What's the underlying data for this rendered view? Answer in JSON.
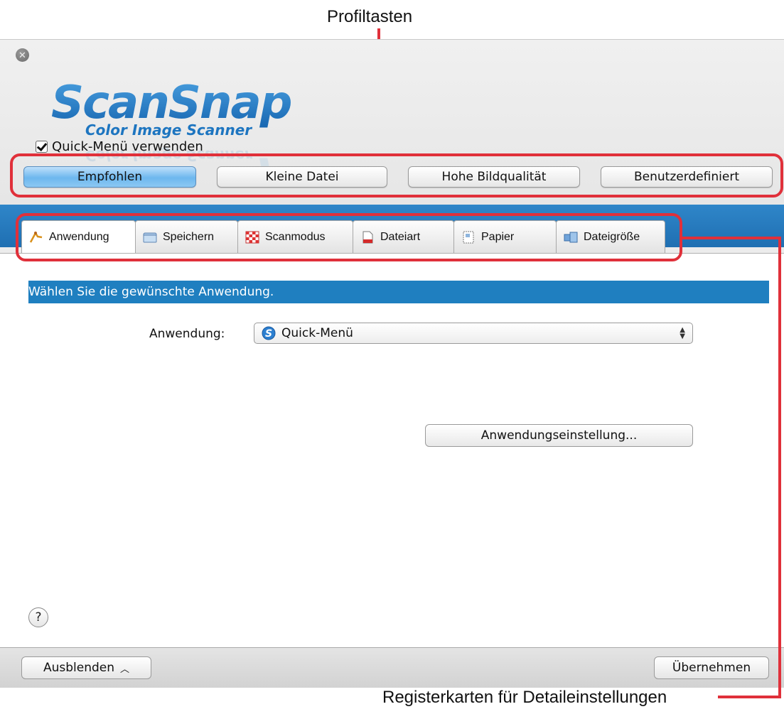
{
  "annotations": {
    "profile_keys": "Profiltasten",
    "detail_tabs": "Registerkarten für Detaileinstellungen",
    "highlight_color": "#e0303a"
  },
  "window": {
    "logo": {
      "brand": "ScanSnap",
      "tagline": "Color Image Scanner"
    },
    "quick_menu_checkbox": {
      "label": "Quick-Menü verwenden",
      "checked": true
    },
    "profiles": [
      {
        "label": "Empfohlen",
        "active": true
      },
      {
        "label": "Kleine Datei",
        "active": false
      },
      {
        "label": "Hohe Bildqualität",
        "active": false
      },
      {
        "label": "Benutzerdefiniert",
        "active": false
      }
    ],
    "tabs": [
      {
        "label": "Anwendung",
        "icon": "application-icon",
        "active": true
      },
      {
        "label": "Speichern",
        "icon": "folder-icon",
        "active": false
      },
      {
        "label": "Scanmodus",
        "icon": "scanmode-icon",
        "active": false
      },
      {
        "label": "Dateiart",
        "icon": "file-type-icon",
        "active": false
      },
      {
        "label": "Papier",
        "icon": "paper-icon",
        "active": false
      },
      {
        "label": "Dateigröße",
        "icon": "file-size-icon",
        "active": false
      }
    ],
    "content": {
      "banner": "Wählen Sie die gewünschte Anwendung.",
      "application_label": "Anwendung:",
      "application_value": "Quick-Menü",
      "application_icon": "scansnap-s-icon",
      "settings_button": "Anwendungseinstellung..."
    },
    "help": "?",
    "footer": {
      "hide_button": "Ausblenden",
      "apply_button": "Übernehmen"
    },
    "colors": {
      "accent_blue": "#1f7fc0",
      "active_profile": "#6db7ee",
      "logo_blue": "#1d75c0"
    }
  }
}
